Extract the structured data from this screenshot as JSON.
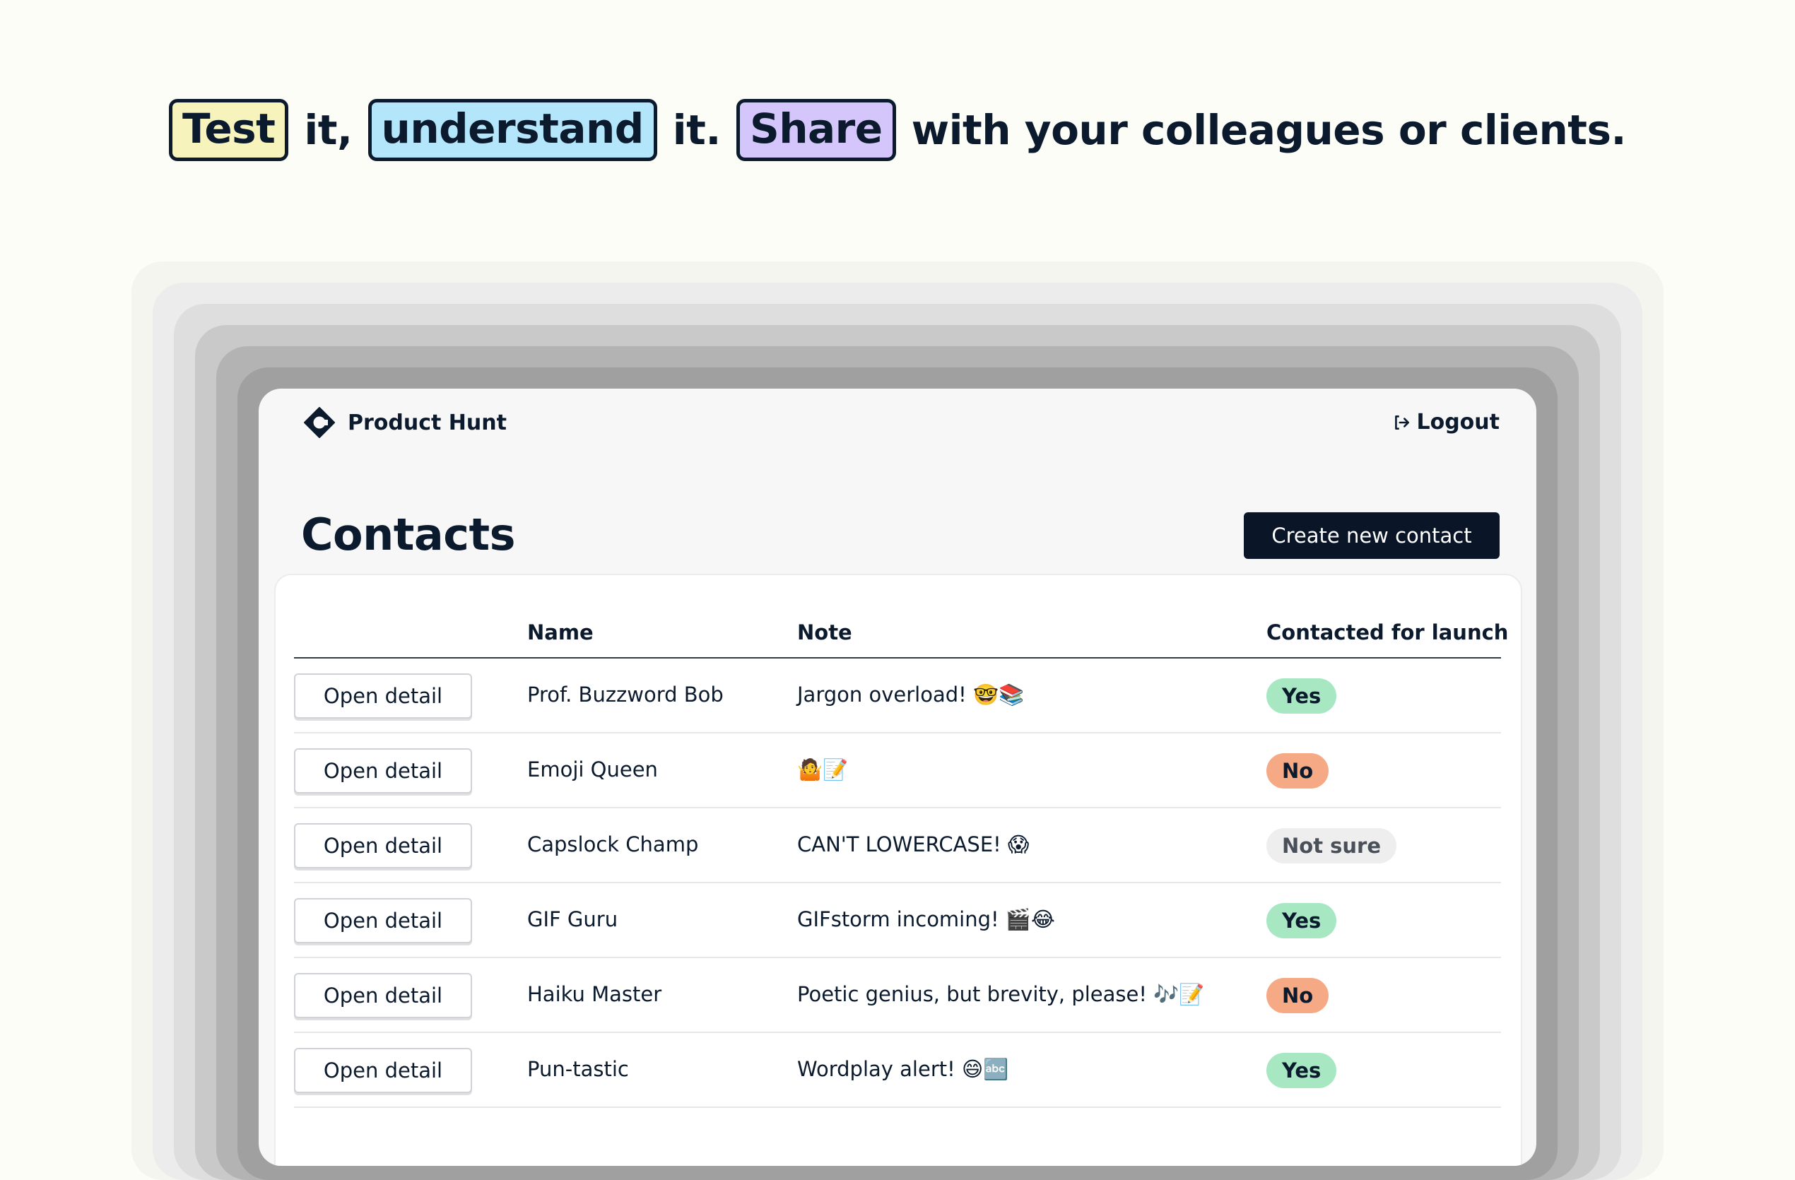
{
  "headline": {
    "word1": "Test",
    "text1": "it,",
    "word2": "understand",
    "text2": "it.",
    "word3": "Share",
    "text3": "with your colleagues or clients.",
    "colors": {
      "word1_bg": "#f6f3bd",
      "word2_bg": "#b3e6fb",
      "word3_bg": "#d4c6fb"
    }
  },
  "app": {
    "brand_name": "Product Hunt",
    "brand_icon": "product-hunt-logo-icon",
    "logout_label": "Logout",
    "logout_icon": "logout-icon",
    "page_title": "Contacts",
    "create_button_label": "Create new contact"
  },
  "table": {
    "columns": [
      "",
      "Name",
      "Note",
      "Contacted for launch"
    ],
    "open_label": "Open detail",
    "status_colors": {
      "Yes": {
        "bg": "#a7e8c3",
        "fg": "#0c1a2e"
      },
      "No": {
        "bg": "#f6a985",
        "fg": "#0c1a2e"
      },
      "Not sure": {
        "bg": "#eeeeef",
        "fg": "#4a5059"
      }
    },
    "rows": [
      {
        "name": "Prof. Buzzword Bob",
        "note": "Jargon overload! 🤓📚",
        "status": "Yes"
      },
      {
        "name": "Emoji Queen",
        "note": "🤷📝",
        "status": "No"
      },
      {
        "name": "Capslock Champ",
        "note": "CAN'T LOWERCASE! 😱",
        "status": "Not sure"
      },
      {
        "name": "GIF Guru",
        "note": "GIFstorm incoming! 🎬😂",
        "status": "Yes"
      },
      {
        "name": "Haiku Master",
        "note": "Poetic genius, but brevity, please! 🎶📝",
        "status": "No"
      },
      {
        "name": "Pun-tastic",
        "note": "Wordplay alert! 😄🔤",
        "status": "Yes"
      }
    ]
  }
}
